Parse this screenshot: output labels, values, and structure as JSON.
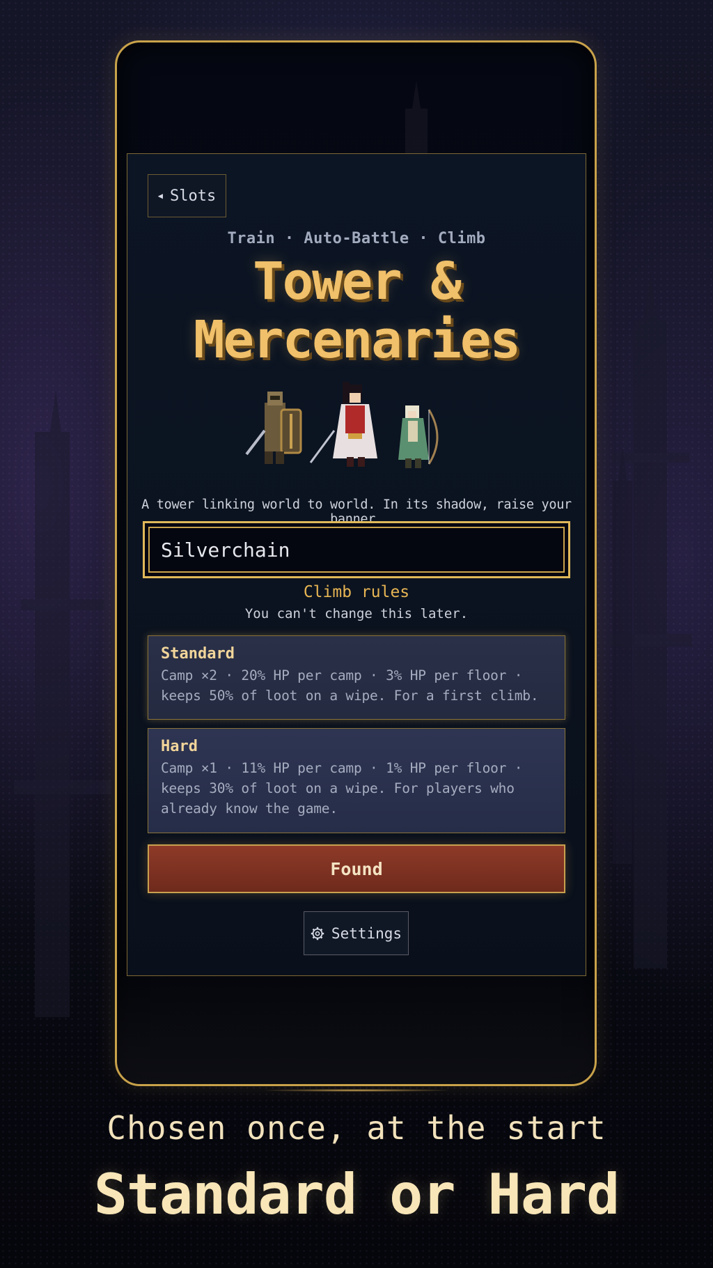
{
  "nav": {
    "slots_label": "Slots"
  },
  "header": {
    "tagline": "Train · Auto-Battle · Climb",
    "title_line1": "Tower &",
    "title_line2": "Mercenaries"
  },
  "heroes": [
    "knight",
    "samurai",
    "elf-archer"
  ],
  "lore": "A tower linking world to world. In its shadow, raise your banner.",
  "name_input": {
    "value": "Silverchain"
  },
  "rules": {
    "title": "Climb rules",
    "subtitle": "You can't change this later.",
    "options": [
      {
        "title": "Standard",
        "description": "Camp ×2 · 20% HP per camp · 3% HP per floor · keeps 50% of loot on a wipe. For a first climb.",
        "selected": true
      },
      {
        "title": "Hard",
        "description": "Camp ×1 · 11% HP per camp · 1% HP per floor · keeps 30% of loot on a wipe. For players who already know the game.",
        "selected": false
      }
    ]
  },
  "actions": {
    "found_label": "Found",
    "settings_label": "Settings"
  },
  "caption": {
    "line1": "Chosen once, at the start",
    "line2": "Standard or Hard"
  },
  "colors": {
    "gold": "#e0b85a",
    "found_red": "#8e3a28",
    "panel": "#0c1524"
  }
}
